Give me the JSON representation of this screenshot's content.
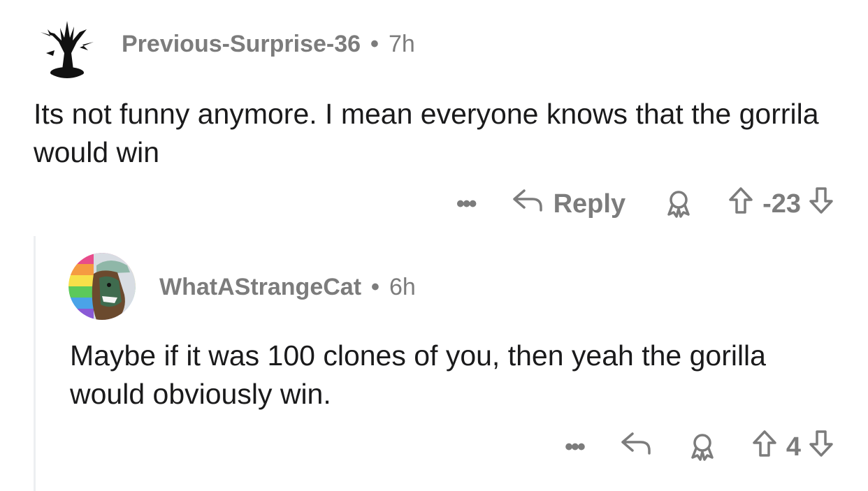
{
  "comments": [
    {
      "username": "Previous-Surprise-36",
      "separator": "•",
      "time": "7h",
      "body": "Its not funny anymore. I mean everyone knows that the gorrila would win",
      "actions": {
        "more": "•••",
        "reply_label": "Reply",
        "score": "-23"
      }
    },
    {
      "username": "WhatAStrangeCat",
      "separator": "•",
      "time": "6h",
      "body": "Maybe if it was 100 clones of you, then yeah the gorilla would obviously win.",
      "actions": {
        "more": "•••",
        "score": "4"
      }
    }
  ],
  "icons": {
    "more": "more-options-icon",
    "reply": "reply-arrow-icon",
    "award": "award-icon",
    "upvote": "upvote-arrow-icon",
    "downvote": "downvote-arrow-icon"
  },
  "colors": {
    "meta_text": "#7c7c7c",
    "body_text": "#1a1a1b",
    "thread_line": "#edeff1"
  }
}
